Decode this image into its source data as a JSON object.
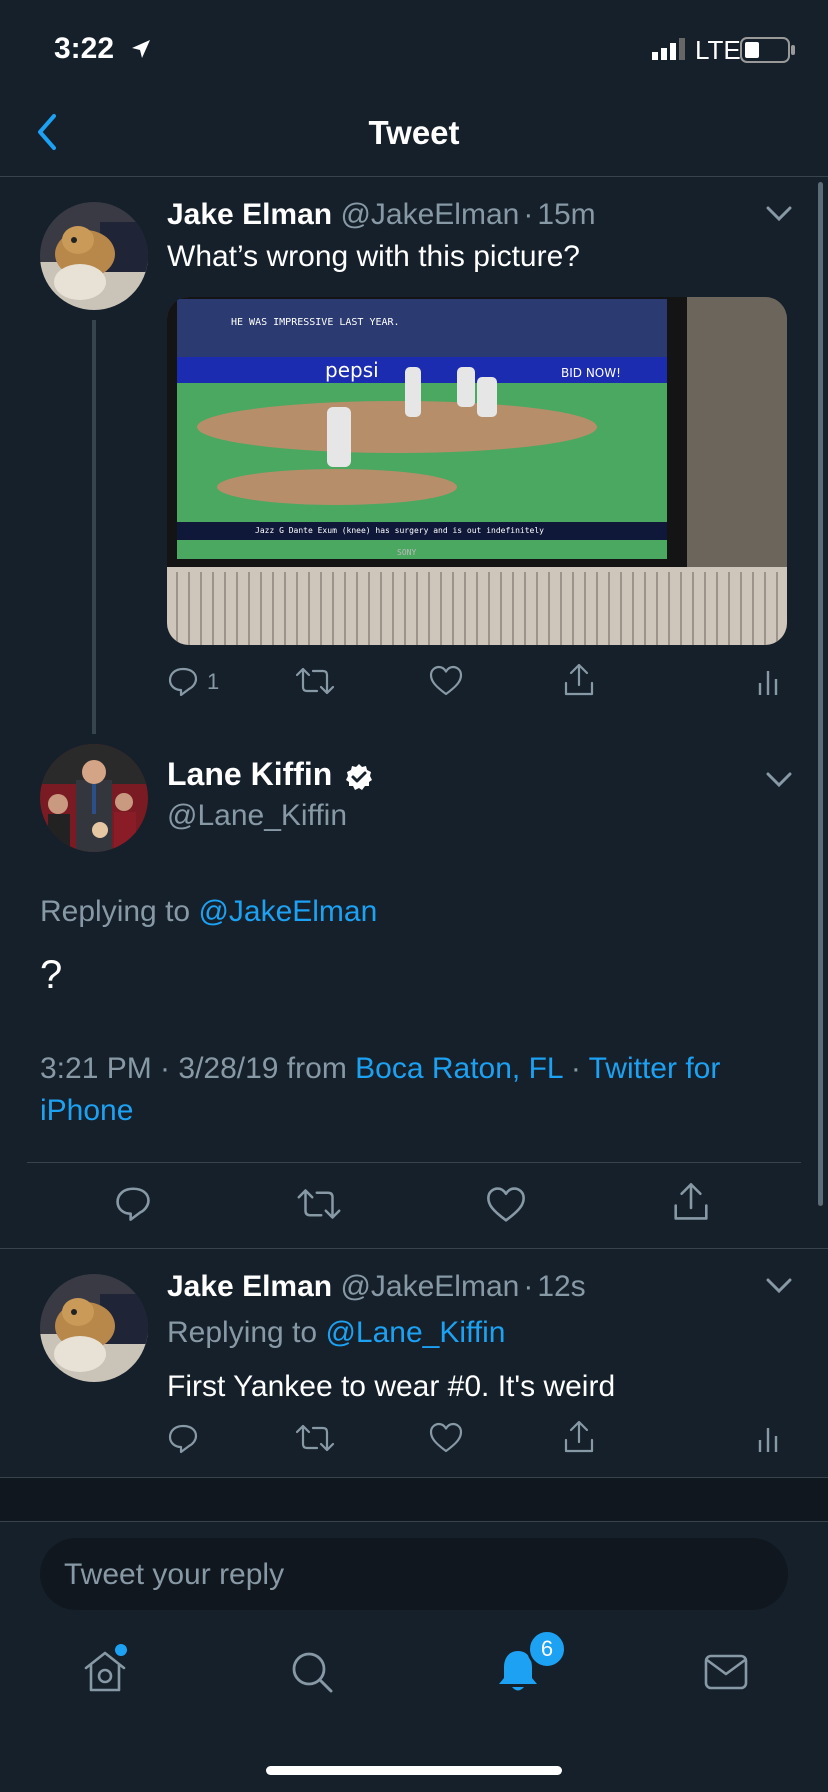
{
  "status_bar": {
    "time": "3:22",
    "network": "LTE"
  },
  "header": {
    "title": "Tweet"
  },
  "tweet1": {
    "name": "Jake Elman",
    "handle": "@JakeElman",
    "sep": "·",
    "time": "15m",
    "text": "What’s wrong with this picture?",
    "image": {
      "scoreboard_text": "HE WAS IMPRESSIVE LAST YEAR.",
      "ticker_text": "Jazz G Dante Exum (knee) has surgery and is out indefinitely",
      "brand": "SONY",
      "ad1": "pepsi",
      "ad2": "BID NOW!"
    },
    "reply_count": "1"
  },
  "main_tweet": {
    "name": "Lane Kiffin",
    "handle": "@Lane_Kiffin",
    "replying_label": "Replying to",
    "replying_handle": "@JakeElman",
    "text": "?",
    "time_date": "3:21 PM · 3/28/19 from",
    "location": "Boca Raton, FL",
    "sep": "·",
    "source_line1": "Twitter for",
    "source_line2": "iPhone"
  },
  "tweet2": {
    "name": "Jake Elman",
    "handle": "@JakeElman",
    "sep": "·",
    "time": "12s",
    "replying_label": "Replying to",
    "replying_handle": "@Lane_Kiffin",
    "text": "First Yankee to wear #0. It's weird"
  },
  "reply_box": {
    "placeholder": "Tweet your reply"
  },
  "tab_bar": {
    "notification_count": "6"
  },
  "colors": {
    "bg": "#15202b",
    "accent": "#1da1f2",
    "muted": "#8899a6",
    "divider": "#38444d"
  }
}
